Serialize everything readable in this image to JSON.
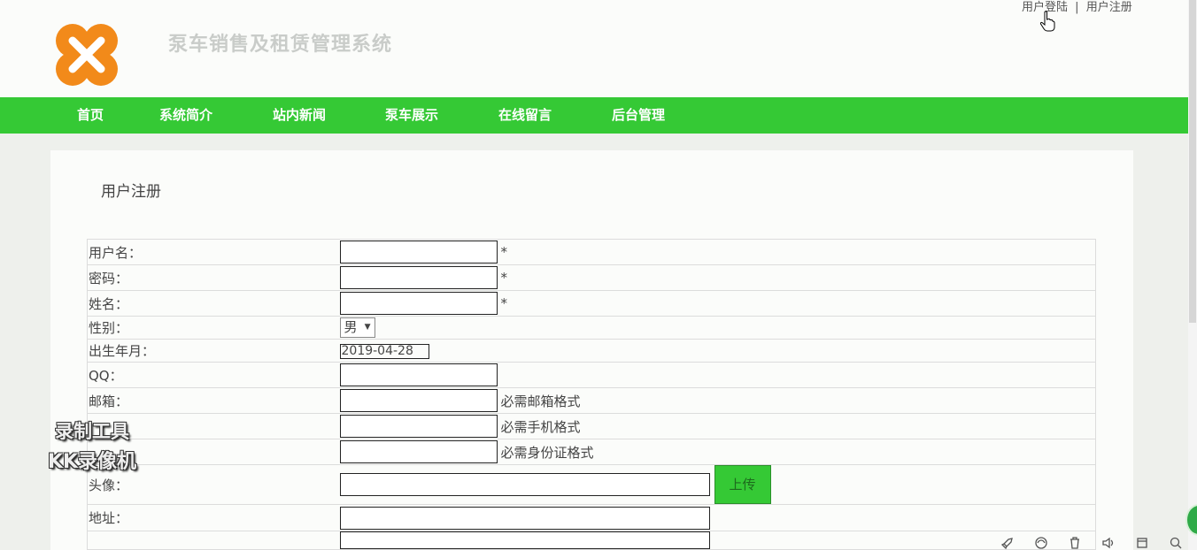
{
  "header": {
    "site_title": "泵车销售及租赁管理系统",
    "login_link": "用户登陆",
    "separator": "|",
    "register_link": "用户注册"
  },
  "nav": {
    "items": [
      {
        "label": "首页"
      },
      {
        "label": "系统简介"
      },
      {
        "label": "站内新闻"
      },
      {
        "label": "泵车展示"
      },
      {
        "label": "在线留言"
      },
      {
        "label": "后台管理"
      }
    ]
  },
  "colors": {
    "accent": "#35c935",
    "logo": "#f28a1a"
  },
  "form": {
    "title": "用户注册",
    "username_label": "用户名：",
    "password_label": "密码：",
    "name_label": "姓名：",
    "gender_label": "性别：",
    "gender_value": "男",
    "birth_label": "出生年月：",
    "birth_value": "2019-04-28",
    "qq_label": "QQ：",
    "email_label": "邮箱：",
    "email_hint": "必需邮箱格式",
    "phone_hint": "必需手机格式",
    "idcard_hint": "必需身份证格式",
    "avatar_label": "头像：",
    "upload_button": "上传",
    "address_label": "地址：",
    "required_mark": "*"
  },
  "watermark": {
    "line1": "录制工具",
    "line2": "KK录像机"
  }
}
